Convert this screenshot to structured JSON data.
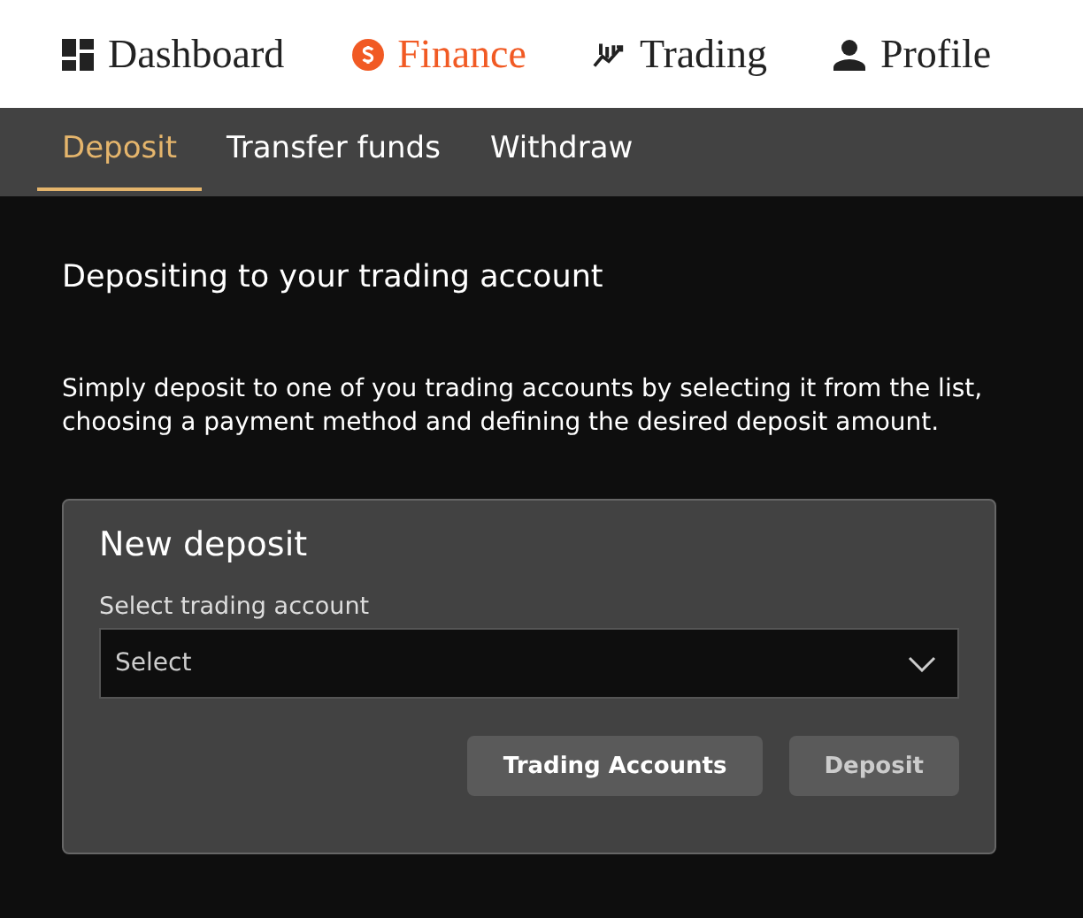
{
  "nav": [
    {
      "label": "Dashboard",
      "selected": false
    },
    {
      "label": "Finance",
      "selected": true
    },
    {
      "label": "Trading",
      "selected": false
    },
    {
      "label": "Profile",
      "selected": false
    }
  ],
  "tabs": [
    {
      "label": "Deposit",
      "selected": true
    },
    {
      "label": "Transfer funds",
      "selected": false
    },
    {
      "label": "Withdraw",
      "selected": false
    }
  ],
  "heading": "Depositing to your trading account",
  "intro": "Simply deposit to one of you trading accounts by selecting it from the list, choosing a payment method and defining the desired deposit amount.",
  "card": {
    "title": "New deposit",
    "field_label": "Select trading account",
    "select": {
      "value": "Select"
    },
    "buttons": [
      {
        "label": "Trading Accounts",
        "disabled": false
      },
      {
        "label": "Deposit",
        "disabled": true
      }
    ]
  }
}
